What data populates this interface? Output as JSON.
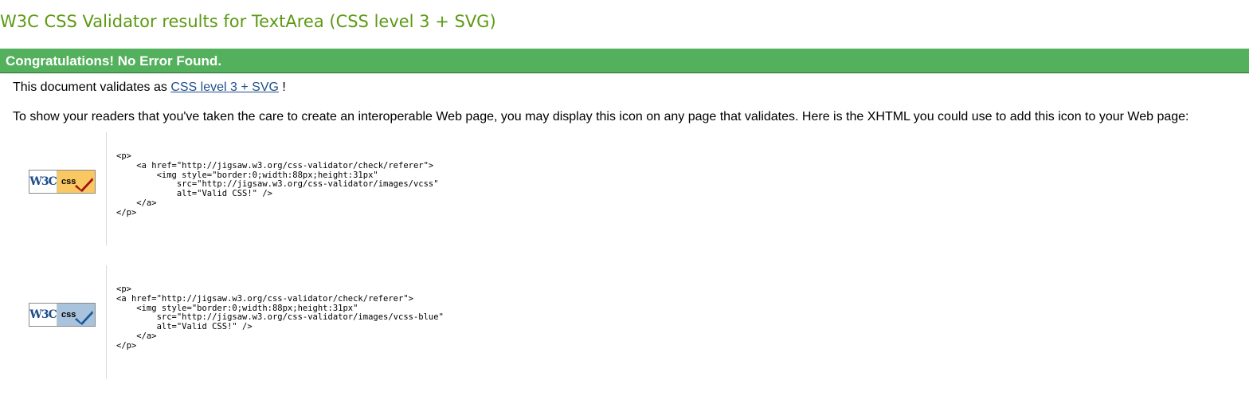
{
  "header": {
    "title": "W3C CSS Validator results for TextArea (CSS level 3 + SVG)"
  },
  "banner": {
    "text": "Congratulations! No Error Found."
  },
  "intro": {
    "prefix": "This document validates as ",
    "link": "CSS level 3 + SVG",
    "suffix": " !"
  },
  "instructions": {
    "text": "To show your readers that you've taken the care to create an interoperable Web page, you may display this icon on any page that validates. Here is the XHTML you could use to add this icon to your Web page:"
  },
  "badges": [
    {
      "w3c": "W3C",
      "label": "css",
      "colors": {
        "panel": "#f9c862",
        "check": "#a01010"
      },
      "icon": "check-icon",
      "code": "<p>\n    <a href=\"http://jigsaw.w3.org/css-validator/check/referer\">\n        <img style=\"border:0;width:88px;height:31px\"\n            src=\"http://jigsaw.w3.org/css-validator/images/vcss\"\n            alt=\"Valid CSS!\" />\n    </a>\n</p>"
    },
    {
      "w3c": "W3C",
      "label": "css",
      "colors": {
        "panel": "#a8c3db",
        "check": "#1d5a9c"
      },
      "icon": "check-icon",
      "code": "<p>\n<a href=\"http://jigsaw.w3.org/css-validator/check/referer\">\n    <img style=\"border:0;width:88px;height:31px\"\n        src=\"http://jigsaw.w3.org/css-validator/images/vcss-blue\"\n        alt=\"Valid CSS!\" />\n    </a>\n</p>"
    }
  ]
}
